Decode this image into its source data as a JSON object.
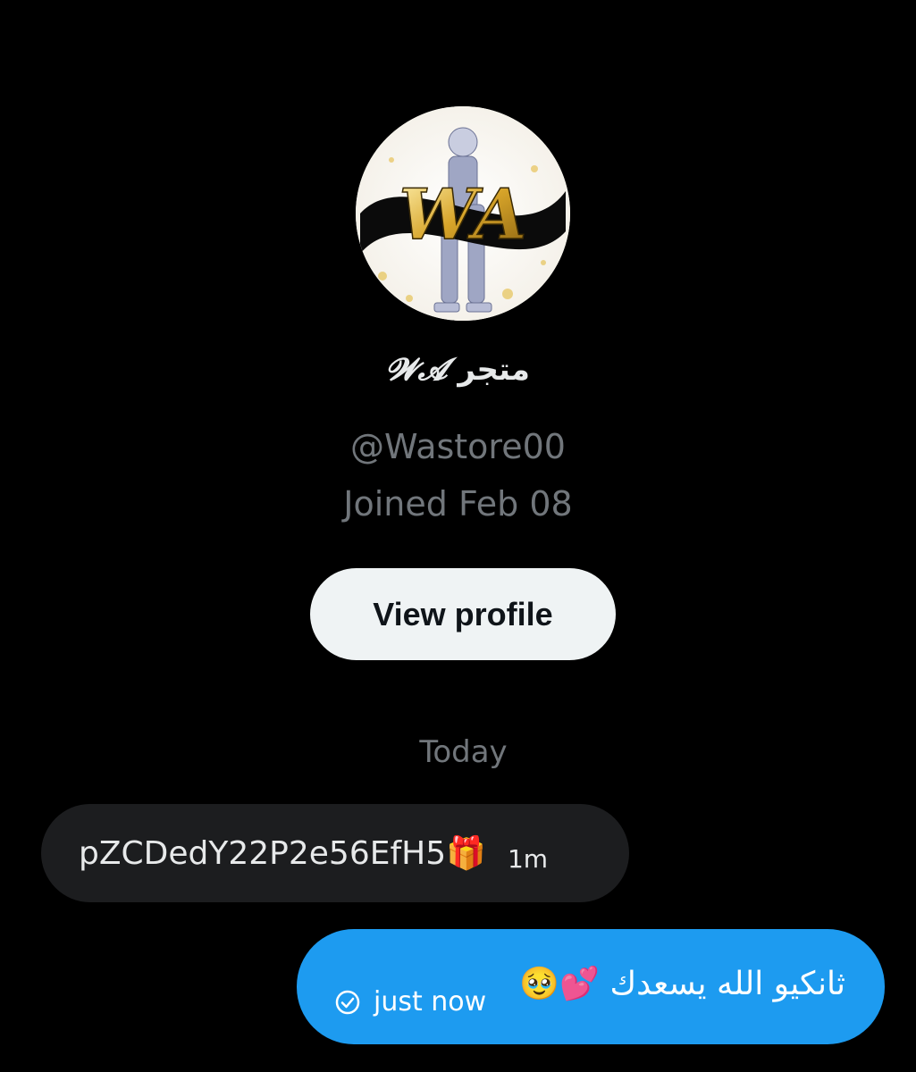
{
  "profile": {
    "display_name_arabic": "متجر",
    "display_name_logo": "𝓦𝓐",
    "handle": "@Wastore00",
    "joined": "Joined Feb 08",
    "view_profile_label": "View profile"
  },
  "conversation": {
    "day_label": "Today",
    "messages": [
      {
        "direction": "incoming",
        "text": "pZCDedY22P2e56EfH5🎁",
        "time": "1m"
      },
      {
        "direction": "outgoing",
        "text": "ثانكيو الله يسعدك 💕🥹",
        "status_icon": "check-circle-icon",
        "time": "just now"
      }
    ]
  },
  "colors": {
    "background": "#000000",
    "outgoing_bubble": "#1d9bf0",
    "incoming_bubble": "#1c1d1f",
    "muted_text": "#71767b",
    "button_bg": "#eff3f4"
  }
}
